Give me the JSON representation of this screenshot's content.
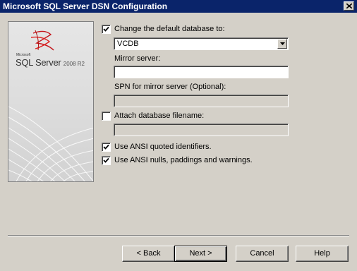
{
  "window": {
    "title": "Microsoft SQL Server DSN Configuration"
  },
  "banner": {
    "brand_small": "Microsoft",
    "product": "SQL Server",
    "version": "2008 R2"
  },
  "options": {
    "change_default_db": {
      "label": "Change the default database to:",
      "checked": true
    },
    "database": {
      "value": "VCDB"
    },
    "mirror_server": {
      "label": "Mirror server:",
      "value": ""
    },
    "spn": {
      "label": "SPN for mirror server (Optional):",
      "value": ""
    },
    "attach_db": {
      "label": "Attach database filename:",
      "checked": false,
      "value": ""
    },
    "ansi_quoted": {
      "label": "Use ANSI quoted identifiers.",
      "checked": true
    },
    "ansi_nulls": {
      "label": "Use ANSI nulls, paddings and warnings.",
      "checked": true
    }
  },
  "buttons": {
    "back": "< Back",
    "next": "Next >",
    "cancel": "Cancel",
    "help": "Help"
  },
  "icons": {
    "close": "close-icon",
    "dropdown": "chevron-down-icon",
    "check": "checkmark-icon"
  }
}
